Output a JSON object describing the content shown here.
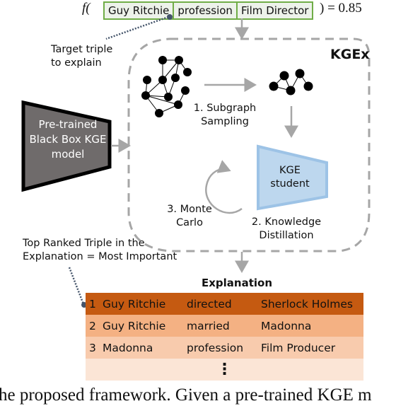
{
  "formula": {
    "prefix": "f(",
    "suffix": ") = 0.85",
    "target_triple": {
      "head": "Guy Ritchie",
      "relation": "profession",
      "tail": "Film Director"
    }
  },
  "annotations": {
    "target_label": [
      "Target triple",
      "to explain"
    ],
    "top_ranked_label": [
      "Top Ranked Triple in the",
      "Explanation = Most Important"
    ]
  },
  "teacher_model": {
    "label": [
      "Pre-trained",
      "Black Box KGE",
      "model"
    ]
  },
  "framework": {
    "title": "KGEx",
    "step1": [
      "1. Subgraph",
      "Sampling"
    ],
    "step2": [
      "2. Knowledge",
      "Distillation"
    ],
    "step3": [
      "3. Monte",
      "Carlo"
    ],
    "student": [
      "KGE",
      "student"
    ]
  },
  "explanation": {
    "title": "Explanation",
    "rows": [
      {
        "rank": "1",
        "head": "Guy Ritchie",
        "relation": "directed",
        "tail": "Sherlock Holmes",
        "color": "#c55a11"
      },
      {
        "rank": "2",
        "head": "Guy Ritchie",
        "relation": "married",
        "tail": "Madonna",
        "color": "#f4b183"
      },
      {
        "rank": "3",
        "head": "Madonna",
        "relation": "profession",
        "tail": "Film Producer",
        "color": "#f8cbad"
      }
    ],
    "ellipsis": "⋮",
    "ellipsis_color": "#fbe5d6"
  },
  "caption_fragment": "he proposed framework. Given a pre-trained KGE m",
  "colors": {
    "triple_border": "#70ad47",
    "triple_fill": "#edf2ea",
    "teacher_fill": "#6f6b6b",
    "student_fill": "#bdd7ee",
    "student_border": "#9dc3e6",
    "arrow_gray": "#a6a6a6",
    "pointer_dot": "#44546a"
  }
}
